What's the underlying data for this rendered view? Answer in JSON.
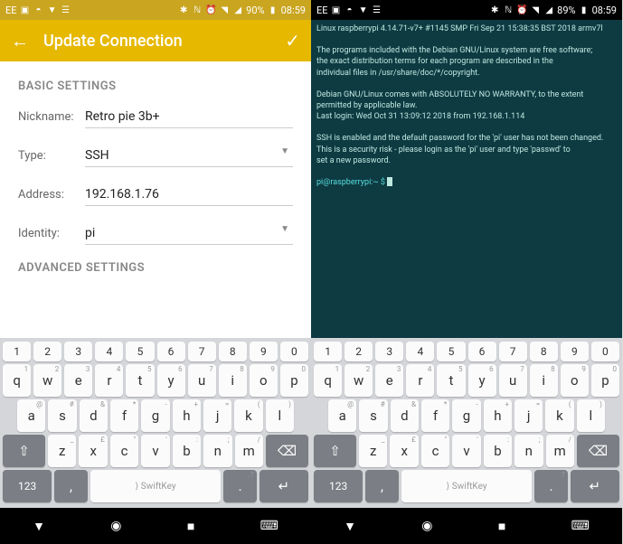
{
  "left": {
    "status": {
      "carrier": "EE",
      "battery": "90%",
      "time": "08:59"
    },
    "toolbar": {
      "title": "Update Connection"
    },
    "section1": "BASIC SETTINGS",
    "section2": "ADVANCED SETTINGS",
    "fields": {
      "nickname": {
        "label": "Nickname:",
        "value": "Retro pie 3b+"
      },
      "type": {
        "label": "Type:",
        "value": "SSH"
      },
      "address": {
        "label": "Address:",
        "value": "192.168.1.76"
      },
      "identity": {
        "label": "Identity:",
        "value": "pi"
      }
    }
  },
  "right": {
    "status": {
      "carrier": "EE",
      "battery": "89%",
      "time": "08:59"
    },
    "terminal": {
      "line1": "Linux raspberrypi 4.14.71-v7+ #1145 SMP Fri Sep 21 15:38:35 BST 2018 armv7l",
      "line2": "",
      "line3": "The programs included with the Debian GNU/Linux system are free software;",
      "line4": "the exact distribution terms for each program are described in the",
      "line5": "individual files in /usr/share/doc/*/copyright.",
      "line6": "",
      "line7": "Debian GNU/Linux comes with ABSOLUTELY NO WARRANTY, to the extent",
      "line8": "permitted by applicable law.",
      "line9": "Last login: Wed Oct 31 13:09:12 2018 from 192.168.1.114",
      "line10": "",
      "line11": "SSH is enabled and the default password for the 'pi' user has not been changed.",
      "line12": "This is a security risk - please login as the 'pi' user and type 'passwd' to",
      "line13": "set a new password.",
      "line14": "",
      "prompt": "pi@raspberrypi:~ $ "
    }
  },
  "keyboard": {
    "nums": [
      "1",
      "2",
      "3",
      "4",
      "5",
      "6",
      "7",
      "8",
      "9",
      "0"
    ],
    "row1": [
      {
        "k": "q",
        "a": "1"
      },
      {
        "k": "w",
        "a": "2"
      },
      {
        "k": "e",
        "a": "3"
      },
      {
        "k": "r",
        "a": "4"
      },
      {
        "k": "t",
        "a": "5"
      },
      {
        "k": "y",
        "a": "6"
      },
      {
        "k": "u",
        "a": "7"
      },
      {
        "k": "i",
        "a": "8"
      },
      {
        "k": "o",
        "a": "9"
      },
      {
        "k": "p",
        "a": "0"
      }
    ],
    "row2": [
      {
        "k": "a",
        "a": "@"
      },
      {
        "k": "s",
        "a": "#"
      },
      {
        "k": "d",
        "a": "&"
      },
      {
        "k": "f",
        "a": "*"
      },
      {
        "k": "g",
        "a": "-"
      },
      {
        "k": "h",
        "a": "+"
      },
      {
        "k": "j",
        "a": "="
      },
      {
        "k": "k",
        "a": "("
      },
      {
        "k": "l",
        "a": ")"
      }
    ],
    "row3": [
      {
        "k": "z",
        "a": "_"
      },
      {
        "k": "x",
        "a": "£"
      },
      {
        "k": "c",
        "a": "\""
      },
      {
        "k": "v",
        "a": "'"
      },
      {
        "k": "b",
        "a": ":"
      },
      {
        "k": "n",
        "a": ";"
      },
      {
        "k": "m",
        "a": "/"
      }
    ],
    "bottom": {
      "numkey": "123",
      "comma": ",",
      "space": "SwiftKey",
      "period": ".",
      "altperiod": ".?"
    }
  }
}
